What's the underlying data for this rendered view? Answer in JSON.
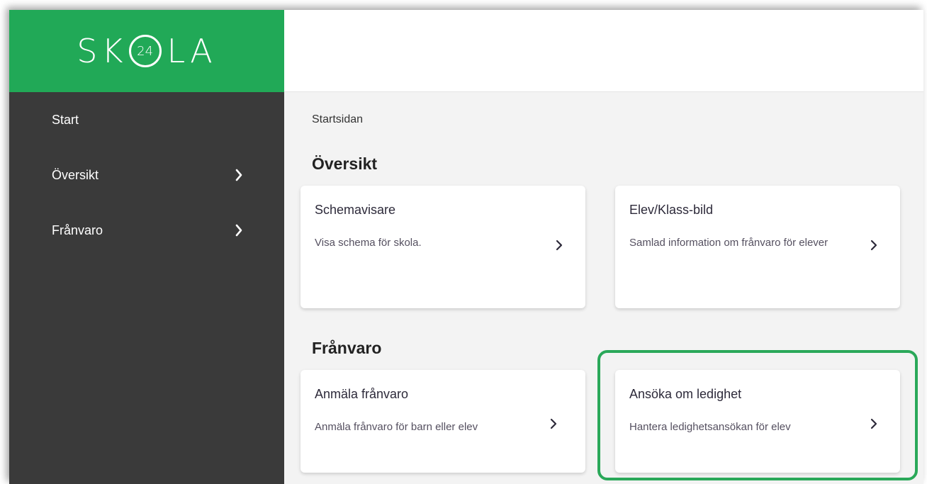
{
  "logo": {
    "part1": "SK",
    "badge": "24",
    "part2": "LA"
  },
  "sidebar": {
    "items": [
      {
        "label": "Start",
        "has_chevron": false
      },
      {
        "label": "Översikt",
        "has_chevron": true
      },
      {
        "label": "Frånvaro",
        "has_chevron": true
      }
    ]
  },
  "main": {
    "breadcrumb": "Startsidan",
    "sections": [
      {
        "title": "Översikt",
        "cards": [
          {
            "title": "Schemavisare",
            "description": "Visa schema för skola.",
            "icon": "chevron-right-icon"
          },
          {
            "title": "Elev/Klass-bild",
            "description": "Samlad information om frånvaro för elever",
            "icon": "chevron-right-icon"
          }
        ]
      },
      {
        "title": "Frånvaro",
        "cards": [
          {
            "title": "Anmäla frånvaro",
            "description": "Anmäla frånvaro för barn eller elev",
            "icon": "chevron-right-icon"
          },
          {
            "title": "Ansöka om ledighet",
            "description": "Hantera ledighetsansökan för elev",
            "icon": "chevron-right-icon",
            "highlighted": true
          }
        ]
      }
    ]
  },
  "colors": {
    "brand_green": "#21a957",
    "sidebar_bg": "#3a3a3a",
    "highlight_border": "#2aa859",
    "content_bg": "#f3f3f3"
  }
}
